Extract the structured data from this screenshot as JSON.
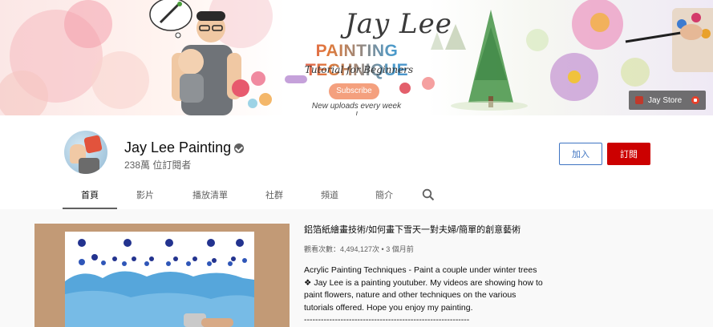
{
  "banner": {
    "title": "Jay Lee",
    "headline": "PAINTING TECHNIQUE",
    "tagline": "Tutorial for Beginners",
    "subscribe_badge": "Subscribe",
    "uploads_note": "New uploads every week !",
    "store_link": "Jay Store"
  },
  "channel": {
    "name": "Jay Lee Painting",
    "subscribers": "238萬 位訂閱者",
    "join_label": "加入",
    "subscribe_label": "訂閱"
  },
  "tabs": [
    {
      "label": "首頁",
      "active": true
    },
    {
      "label": "影片",
      "active": false
    },
    {
      "label": "播放清單",
      "active": false
    },
    {
      "label": "社群",
      "active": false
    },
    {
      "label": "頻道",
      "active": false
    },
    {
      "label": "簡介",
      "active": false
    }
  ],
  "icons": {
    "search": "search-icon",
    "verified": "verified-check-icon",
    "external": "external-link-icon"
  },
  "featured": {
    "title": "鋁箔紙繪畫技術/如何畫下雪天一對夫婦/簡單的創意藝術",
    "meta": "觀看次數：4,494,127次 • 3 個月前",
    "description": [
      "Acrylic Painting Techniques - Paint a couple under winter trees",
      "❖ Jay Lee is a painting youtuber. My videos are showing how to",
      "paint flowers, nature and other techniques on the various",
      "tutorials offered. Hope you enjoy my painting.",
      "-----------------------------------------------------------"
    ]
  },
  "colors": {
    "subscribe_red": "#cc0000",
    "join_blue": "#3e74c2",
    "page_bg": "#f9f9f9"
  }
}
